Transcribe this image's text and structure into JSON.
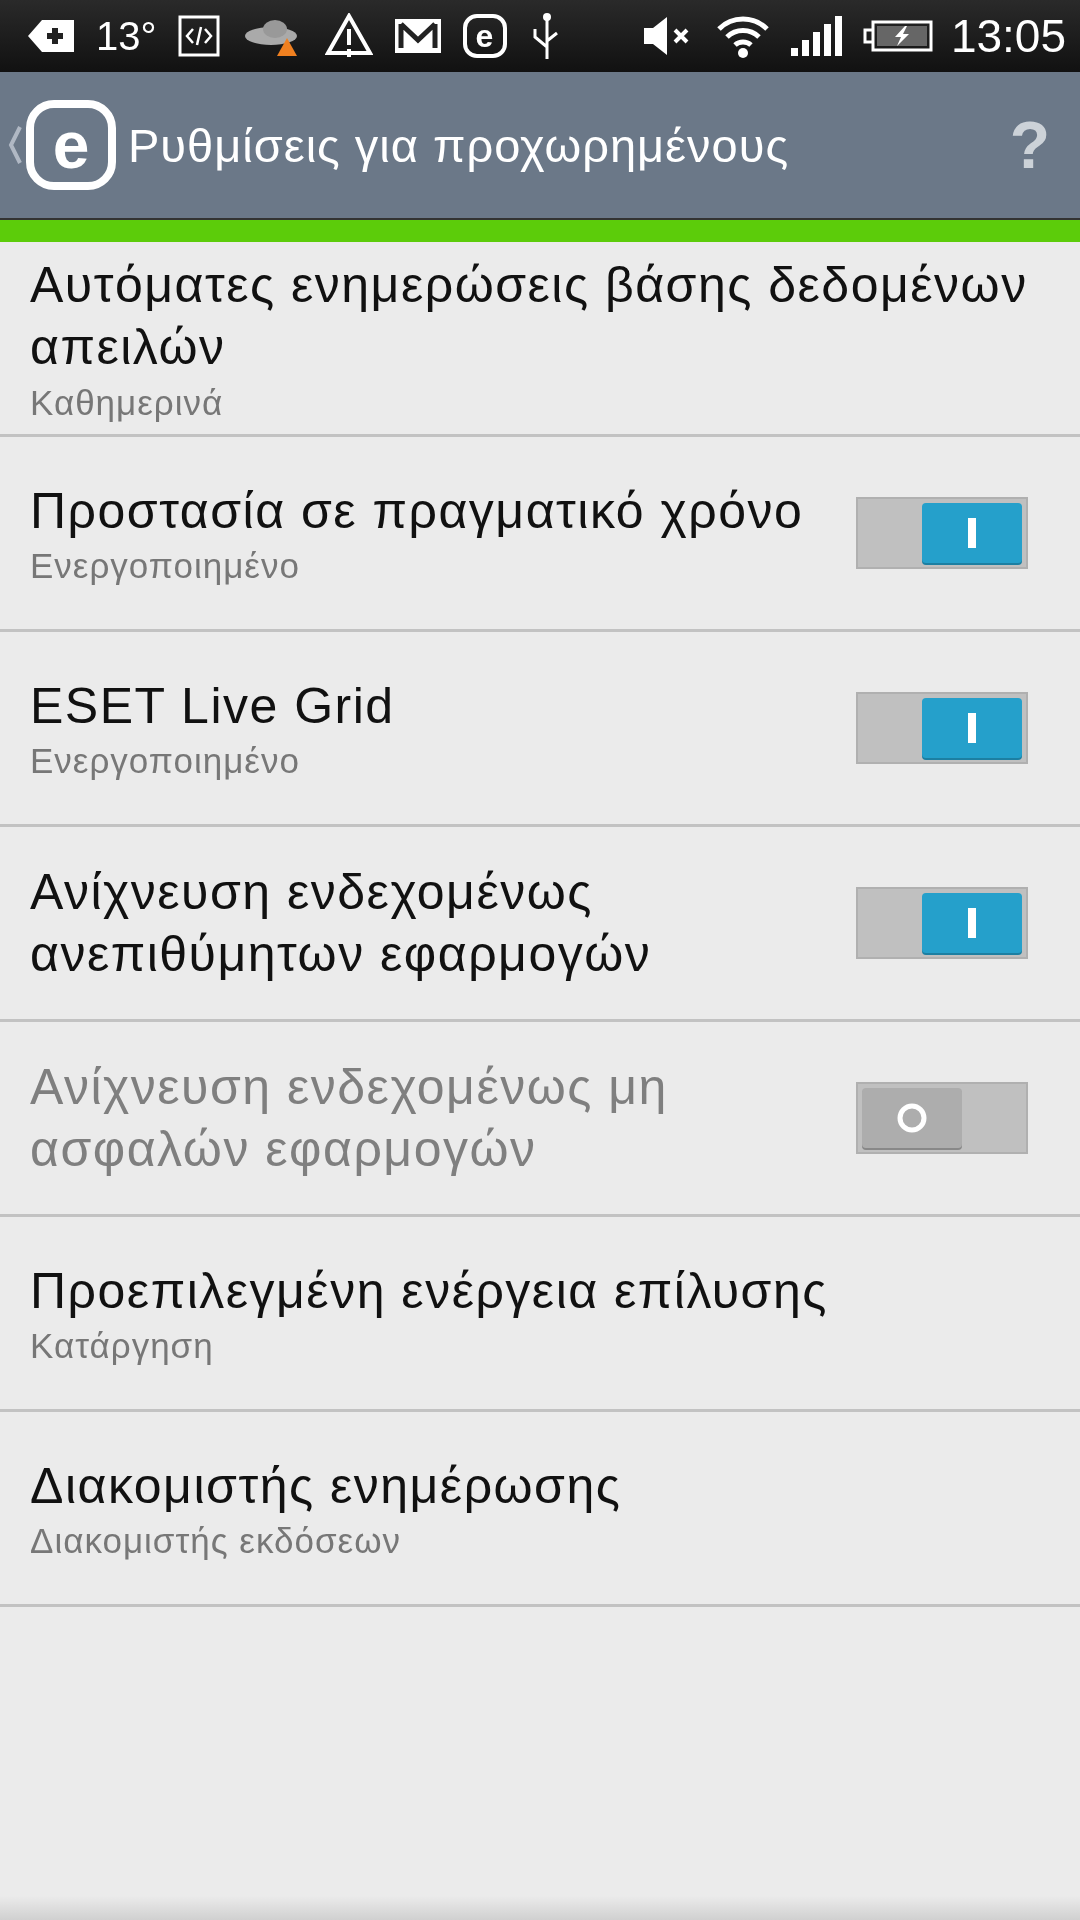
{
  "status_bar": {
    "temperature": "13°",
    "eset_letter": "e",
    "time": "13:05"
  },
  "header": {
    "logo_letter": "e",
    "title": "Ρυθμίσεις για προχωρημένους",
    "help": "?"
  },
  "settings": [
    {
      "kind": "text",
      "title": "Αυτόματες ενημερώσεις βάσης δεδομένων απειλών",
      "subtitle": "Καθημερινά"
    },
    {
      "kind": "toggle",
      "title": "Προστασία σε πραγματικό χρόνο",
      "subtitle": "Ενεργοποιημένο",
      "on": true,
      "disabled": false
    },
    {
      "kind": "toggle",
      "title": "ESET Live Grid",
      "subtitle": "Ενεργοποιημένο",
      "on": true,
      "disabled": false
    },
    {
      "kind": "toggle",
      "title": "Ανίχνευση ενδεχομένως ανεπιθύμητων εφαρμογών",
      "on": true,
      "disabled": false
    },
    {
      "kind": "toggle",
      "title": "Ανίχνευση ενδεχομένως μη ασφαλών εφαρμογών",
      "on": false,
      "disabled": true
    },
    {
      "kind": "text",
      "title": "Προεπιλεγμένη ενέργεια επίλυσης",
      "subtitle": "Κατάργηση"
    },
    {
      "kind": "text",
      "title": "Διακομιστής ενημέρωσης",
      "subtitle": "Διακομιστής εκδόσεων"
    }
  ]
}
